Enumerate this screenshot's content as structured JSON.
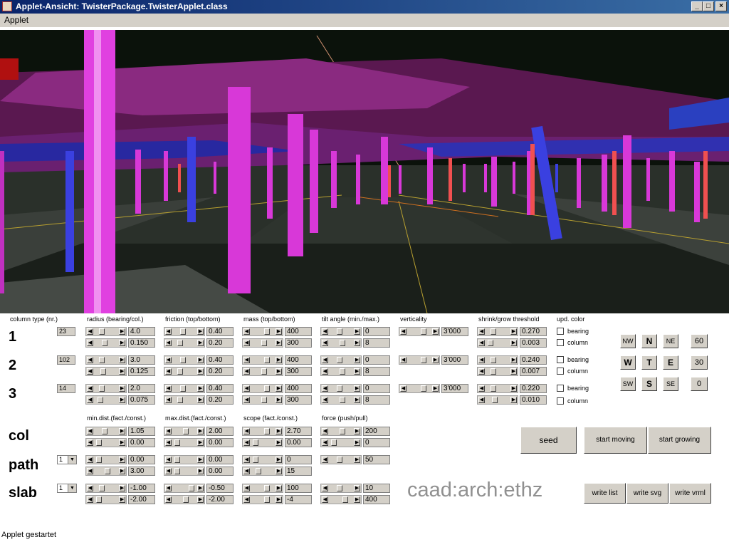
{
  "window": {
    "title": "Applet-Ansicht: TwisterPackage.TwisterApplet.class"
  },
  "menu": {
    "applet": "Applet"
  },
  "headers": {
    "column_type": "column type (nr.)",
    "radius": "radius (bearing/col.)",
    "friction": "friction (top/bottom)",
    "mass": "mass (top/bottom)",
    "tilt": "tilt angle (min./max.)",
    "verticality": "verticality",
    "shrink": "shrink/grow threshold",
    "upd_color": "upd. color",
    "min_dist": "min.dist.(fact./const.)",
    "max_dist": "max.dist.(fact./const.)",
    "scope": "scope (fact./const.)",
    "force": "force (push/pull)"
  },
  "rows": [
    {
      "label": "1",
      "type_nr": "23",
      "radius": [
        "4.0",
        "0.150"
      ],
      "friction": [
        "0.40",
        "0.20"
      ],
      "mass": [
        "400",
        "300"
      ],
      "tilt": [
        "0",
        "8"
      ],
      "verticality": "3'000",
      "shrink": [
        "0.270",
        "0.003"
      ]
    },
    {
      "label": "2",
      "type_nr": "102",
      "radius": [
        "3.0",
        "0.125"
      ],
      "friction": [
        "0.40",
        "0.20"
      ],
      "mass": [
        "400",
        "300"
      ],
      "tilt": [
        "0",
        "8"
      ],
      "verticality": "3'000",
      "shrink": [
        "0.240",
        "0.007"
      ]
    },
    {
      "label": "3",
      "type_nr": "14",
      "radius": [
        "2.0",
        "0.075"
      ],
      "friction": [
        "0.40",
        "0.20"
      ],
      "mass": [
        "400",
        "300"
      ],
      "tilt": [
        "0",
        "8"
      ],
      "verticality": "3'000",
      "shrink": [
        "0.220",
        "0.010"
      ]
    }
  ],
  "checkbox_labels": {
    "bearing": "bearing",
    "column": "column"
  },
  "agents": [
    {
      "label": "col",
      "select": "",
      "min_dist": [
        "1.05",
        "0.00"
      ],
      "max_dist": [
        "2.00",
        "0.00"
      ],
      "scope": [
        "2.70",
        "0.00"
      ],
      "force": [
        "200",
        "0"
      ]
    },
    {
      "label": "path",
      "select": "1",
      "min_dist": [
        "0.00",
        "3.00"
      ],
      "max_dist": [
        "0.00",
        "0.00"
      ],
      "scope": [
        "0",
        "15"
      ],
      "force": [
        "50"
      ]
    },
    {
      "label": "slab",
      "select": "1",
      "min_dist": [
        "-1.00",
        "-2.00"
      ],
      "max_dist": [
        "-0.50",
        "-2.00"
      ],
      "scope": [
        "100",
        "-4"
      ],
      "force": [
        "10",
        "400"
      ]
    }
  ],
  "directions": {
    "nw": "NW",
    "n": "N",
    "ne": "NE",
    "w": "W",
    "t": "T",
    "e": "E",
    "sw": "SW",
    "s": "S",
    "se": "SE"
  },
  "speed": {
    "s60": "60",
    "s30": "30",
    "s0": "0"
  },
  "buttons": {
    "seed": "seed",
    "start_moving": "start moving",
    "start_growing": "start growing",
    "write_list": "write list",
    "write_svg": "write svg",
    "write_vrml": "write vrml"
  },
  "brand": "caad:arch:ethz",
  "status": "Applet gestartet"
}
